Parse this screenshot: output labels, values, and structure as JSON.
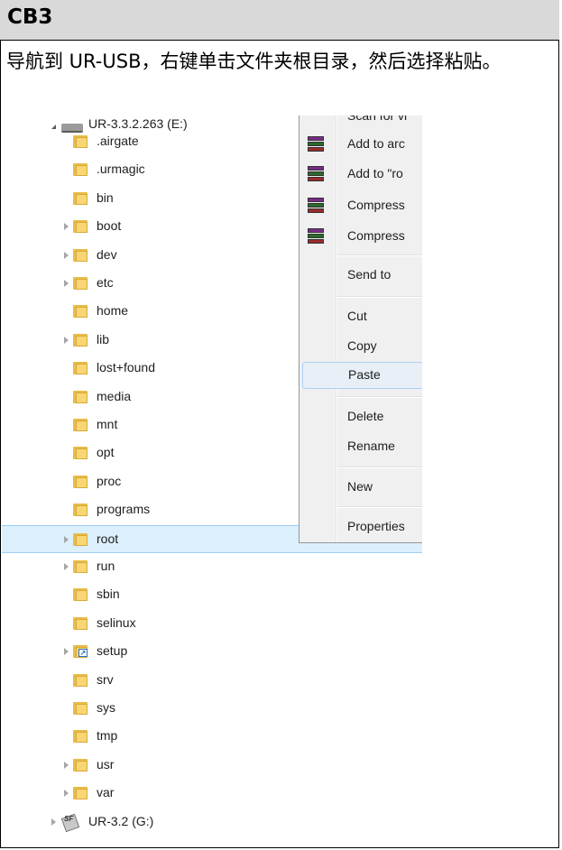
{
  "header": {
    "title": "CB3"
  },
  "instruction": "导航到 UR-USB，右键单击文件夹根目录，然后选择粘贴。",
  "tree": {
    "drive_e": "UR-3.3.2.263 (E:)",
    "folders": [
      ".airgate",
      ".urmagic",
      "bin",
      "boot",
      "dev",
      "etc",
      "home",
      "lib",
      "lost+found",
      "media",
      "mnt",
      "opt",
      "proc",
      "programs",
      "root",
      "run",
      "sbin",
      "selinux",
      "setup",
      "srv",
      "sys",
      "tmp",
      "usr",
      "var"
    ],
    "drive_g": "UR-3.2 (G:)",
    "selected": "root"
  },
  "context_menu": {
    "items": [
      "Scan for vi",
      "Add to arc",
      "Add to \"ro",
      "Compress",
      "Compress",
      "Send to",
      "Cut",
      "Copy",
      "Paste",
      "Delete",
      "Rename",
      "New",
      "Properties"
    ],
    "highlighted": "Paste"
  }
}
